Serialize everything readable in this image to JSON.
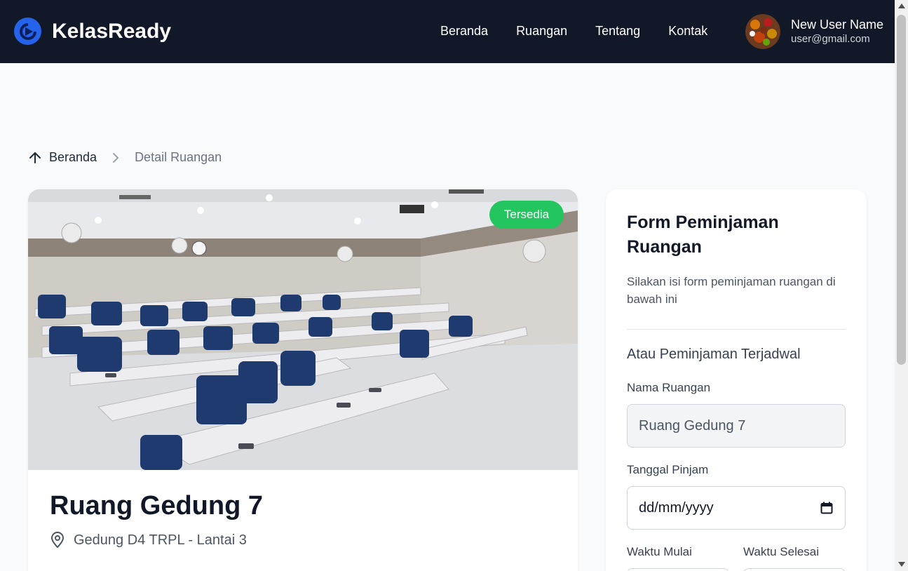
{
  "brand": {
    "name": "KelasReady",
    "accent": "#2563eb"
  },
  "nav": {
    "items": [
      {
        "label": "Beranda"
      },
      {
        "label": "Ruangan"
      },
      {
        "label": "Tentang"
      },
      {
        "label": "Kontak"
      }
    ]
  },
  "user": {
    "name": "New User Name",
    "email": "user@gmail.com"
  },
  "breadcrumb": {
    "home": "Beranda",
    "current": "Detail Ruangan"
  },
  "room": {
    "badge": "Tersedia",
    "badge_color": "#22c55e",
    "title": "Ruang Gedung 7",
    "location": "Gedung D4 TRPL - Lantai 3"
  },
  "form": {
    "title": "Form Peminjaman Ruangan",
    "description": "Silakan isi form peminjaman ruangan di bawah ini",
    "subheading": "Atau Peminjaman Terjadwal",
    "room_name_label": "Nama Ruangan",
    "room_name_value": "Ruang Gedung 7",
    "date_label": "Tanggal Pinjam",
    "date_placeholder": "dd/mm/yyyy",
    "start_label": "Waktu Mulai",
    "end_label": "Waktu Selesai"
  }
}
